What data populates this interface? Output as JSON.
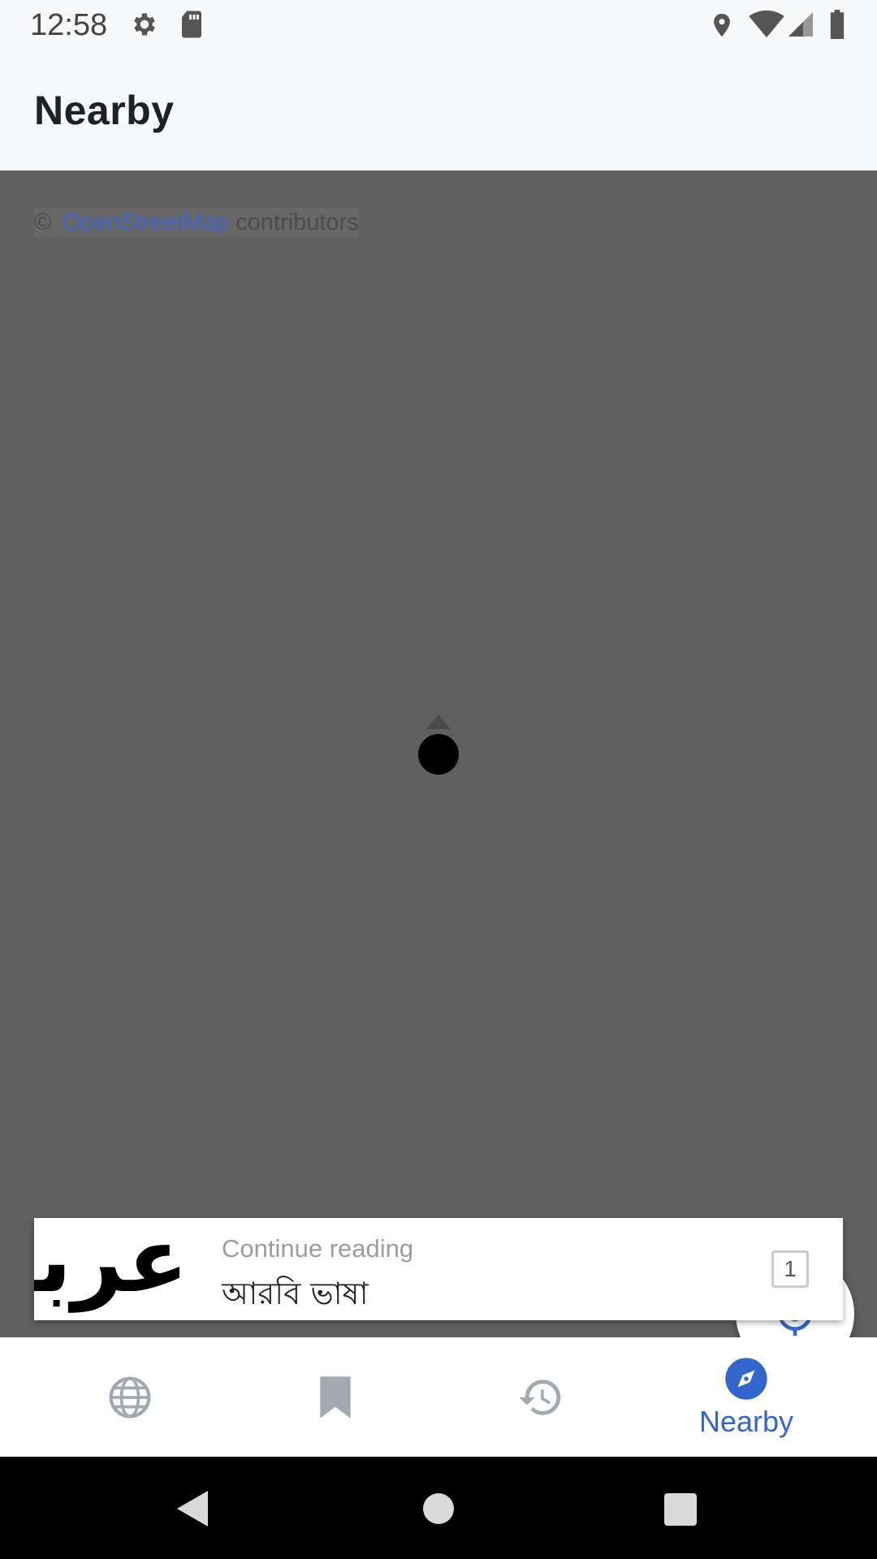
{
  "status_bar": {
    "time": "12:58",
    "left_icons": [
      "settings-icon",
      "sd-card-icon"
    ],
    "right_icons": [
      "location-icon",
      "wifi-icon",
      "signal-icon",
      "battery-icon"
    ]
  },
  "app_bar": {
    "title": "Nearby"
  },
  "map": {
    "attribution_copy": "©",
    "attribution_link": "OpenStreetMap",
    "attribution_suffix": "contributors",
    "background_color": "#606060",
    "locate_button_icon": "my-location-icon"
  },
  "continue_card": {
    "thumbnail_text": "عربية",
    "label": "Continue reading",
    "title": "আরবি ভাষা",
    "tab_count": "1"
  },
  "bottom_nav": {
    "items": [
      {
        "icon": "globe-icon",
        "label": "",
        "active": false
      },
      {
        "icon": "bookmark-icon",
        "label": "",
        "active": false
      },
      {
        "icon": "history-icon",
        "label": "",
        "active": false
      },
      {
        "icon": "compass-icon",
        "label": "Nearby",
        "active": true
      }
    ],
    "accent_color": "#3366cc",
    "inactive_color": "#a2a9b1"
  },
  "system_nav": {
    "buttons": [
      "back-button",
      "home-button",
      "recents-button"
    ]
  }
}
